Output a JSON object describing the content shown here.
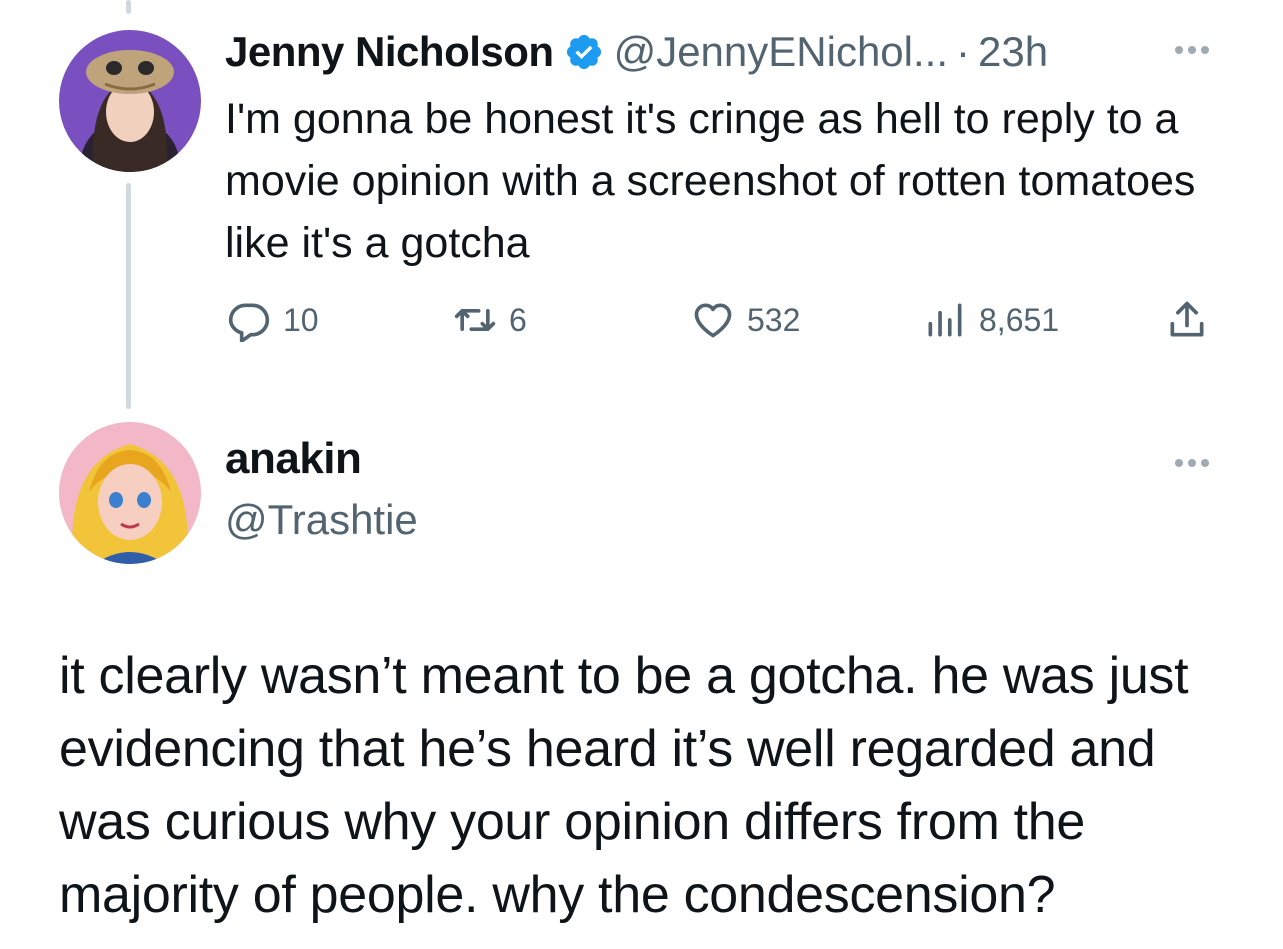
{
  "original_tweet": {
    "author_name": "Jenny Nicholson",
    "handle": "@JennyENichol...",
    "separator": "·",
    "time": "23h",
    "verified": true,
    "text": "I'm gonna be honest it's cringe as hell to reply to a movie opinion with a screenshot of rotten tomatoes like it's a gotcha",
    "counts": {
      "replies": "10",
      "retweets": "6",
      "likes": "532",
      "views": "8,651"
    }
  },
  "reply_tweet": {
    "author_name": "anakin",
    "handle": "@Trashtie",
    "text": "it clearly wasn’t meant to be a gotcha. he was just evidencing that he’s heard it’s well regarded and was curious why your opinion differs from the majority of people. why the condescension?"
  },
  "icons": [
    "reply-icon",
    "retweet-icon",
    "like-icon",
    "views-icon",
    "share-icon",
    "more-icon",
    "verified-badge-icon"
  ],
  "colors": {
    "verified": "#1d9bf0",
    "muted": "#536471",
    "text": "#0f1419",
    "thread_line": "#cfd9de"
  }
}
